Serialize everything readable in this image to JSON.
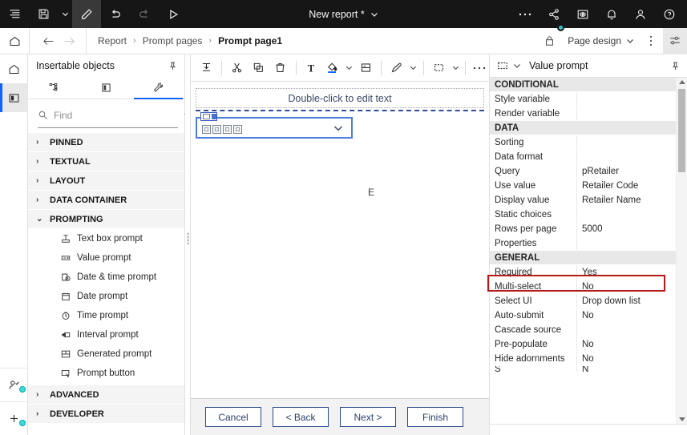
{
  "topbar": {
    "menu_icon": "menu-list-icon",
    "save_icon": "save-icon",
    "save_caret": "chevron-down-icon",
    "edit_icon": "pencil-edit-icon",
    "undo_icon": "undo-icon",
    "redo_icon": "redo-icon",
    "run_icon": "play-run-icon",
    "title": "New report *",
    "title_caret": "chevron-down-icon",
    "more_icon": "overflow-menu-icon",
    "share_icon": "share-icon",
    "preview_icon": "preview-eye-icon",
    "notify_icon": "bell-notification-icon",
    "account_icon": "user-account-icon",
    "help_icon": "help-circle-icon"
  },
  "breadcrumb": {
    "home_icon": "home-icon",
    "back_icon": "arrow-left-icon",
    "forward_icon": "arrow-right-icon",
    "items": [
      {
        "label": "Report",
        "current": false
      },
      {
        "label": "Prompt pages",
        "current": false
      },
      {
        "label": "Prompt page1",
        "current": true
      }
    ],
    "separator": "›",
    "lock_icon": "lock-icon",
    "page_design_label": "Page design",
    "page_design_caret": "chevron-down-icon",
    "kebab_icon": "vertical-overflow-icon",
    "properties_toggle_icon": "sliders-properties-icon"
  },
  "rail": {
    "home_icon": "home-icon",
    "panel_icon": "side-panel-icon",
    "user_add_icon": "user-add-icon",
    "add_icon": "plus-add-icon"
  },
  "left_panel": {
    "title": "Insertable objects",
    "pin_icon": "pin-icon",
    "tabs": [
      {
        "name": "source-tree-tab",
        "icon": "data-source-tree-icon",
        "active": false
      },
      {
        "name": "page-structure-tab",
        "icon": "page-layout-icon",
        "active": false
      },
      {
        "name": "toolbox-tab",
        "icon": "wrench-toolbox-icon",
        "active": true
      }
    ],
    "search": {
      "icon": "search-icon",
      "placeholder": "Find",
      "value": "",
      "caret_icon": "chevron-down-icon"
    },
    "groups": [
      {
        "label": "PINNED",
        "expanded": false,
        "items": []
      },
      {
        "label": "TEXTUAL",
        "expanded": false,
        "items": []
      },
      {
        "label": "LAYOUT",
        "expanded": false,
        "items": []
      },
      {
        "label": "DATA CONTAINER",
        "expanded": false,
        "items": []
      },
      {
        "label": "PROMPTING",
        "expanded": true,
        "items": [
          {
            "label": "Text box prompt",
            "icon": "text-box-prompt-icon"
          },
          {
            "label": "Value prompt",
            "icon": "value-prompt-icon"
          },
          {
            "label": "Date & time prompt",
            "icon": "date-time-prompt-icon"
          },
          {
            "label": "Date prompt",
            "icon": "calendar-date-icon"
          },
          {
            "label": "Time prompt",
            "icon": "clock-time-icon"
          },
          {
            "label": "Interval prompt",
            "icon": "interval-prompt-icon"
          },
          {
            "label": "Generated prompt",
            "icon": "generated-prompt-icon"
          },
          {
            "label": "Prompt button",
            "icon": "prompt-button-icon"
          }
        ]
      },
      {
        "label": "ADVANCED",
        "expanded": false,
        "items": []
      },
      {
        "label": "DEVELOPER",
        "expanded": false,
        "items": []
      }
    ],
    "expand_glyph": "›",
    "collapse_glyph": "⌄"
  },
  "canvas_toolbar": {
    "buttons": [
      {
        "name": "insert-above-button",
        "icon": "insert-row-icon"
      },
      {
        "name": "cut-button",
        "icon": "scissors-cut-icon"
      },
      {
        "name": "copy-button",
        "icon": "copy-icon"
      },
      {
        "name": "delete-button",
        "icon": "trash-delete-icon"
      },
      {
        "name": "font-button",
        "icon": "font-text-icon"
      },
      {
        "name": "background-color-button",
        "icon": "fill-paint-bucket-icon"
      },
      {
        "name": "border-button",
        "icon": "border-box-icon"
      },
      {
        "name": "style-button",
        "icon": "eyedropper-style-icon"
      },
      {
        "name": "select-ancestor-button",
        "icon": "dashed-selection-icon"
      },
      {
        "name": "more-button",
        "icon": "overflow-menu-icon"
      }
    ]
  },
  "canvas": {
    "textbox_placeholder": "Double-click to edit text",
    "prompt_control": {
      "name": "value-prompt-dropdown",
      "caret_icon": "chevron-down-icon",
      "glyph_count": 4,
      "selected": true
    },
    "edge_label": "E"
  },
  "wizard_buttons": [
    {
      "label": "Cancel",
      "name": "cancel-button"
    },
    {
      "label": "< Back",
      "name": "back-button"
    },
    {
      "label": "Next >",
      "name": "next-button"
    },
    {
      "label": "Finish",
      "name": "finish-button"
    }
  ],
  "properties": {
    "header_icon": "dashed-selection-icon",
    "header_caret": "chevron-down-icon",
    "title": "Value prompt",
    "pin_icon": "pin-icon",
    "scroll_up_icon": "caret-up-icon",
    "scroll_down_icon": "caret-down-icon",
    "highlight_color": "#b81818",
    "rows": [
      {
        "key": "CONDITIONAL",
        "value": "",
        "section": true
      },
      {
        "key": "Style variable",
        "value": ""
      },
      {
        "key": "Render variable",
        "value": ""
      },
      {
        "key": "DATA",
        "value": "",
        "section": true
      },
      {
        "key": "Sorting",
        "value": ""
      },
      {
        "key": "Data format",
        "value": ""
      },
      {
        "key": "Query",
        "value": "pRetailer"
      },
      {
        "key": "Use value",
        "value": "Retailer Code"
      },
      {
        "key": "Display value",
        "value": "Retailer Name"
      },
      {
        "key": "Static choices",
        "value": ""
      },
      {
        "key": "Rows per page",
        "value": "5000",
        "highlight": true
      },
      {
        "key": "Properties",
        "value": ""
      },
      {
        "key": "GENERAL",
        "value": "",
        "section": true
      },
      {
        "key": "Required",
        "value": "Yes"
      },
      {
        "key": "Multi-select",
        "value": "No"
      },
      {
        "key": "Select UI",
        "value": "Drop down list"
      },
      {
        "key": "Auto-submit",
        "value": "No"
      },
      {
        "key": "Cascade source",
        "value": ""
      },
      {
        "key": "Pre-populate",
        "value": "No"
      },
      {
        "key": "Hide adornments",
        "value": "No"
      },
      {
        "key": "S",
        "value": "N"
      }
    ]
  }
}
